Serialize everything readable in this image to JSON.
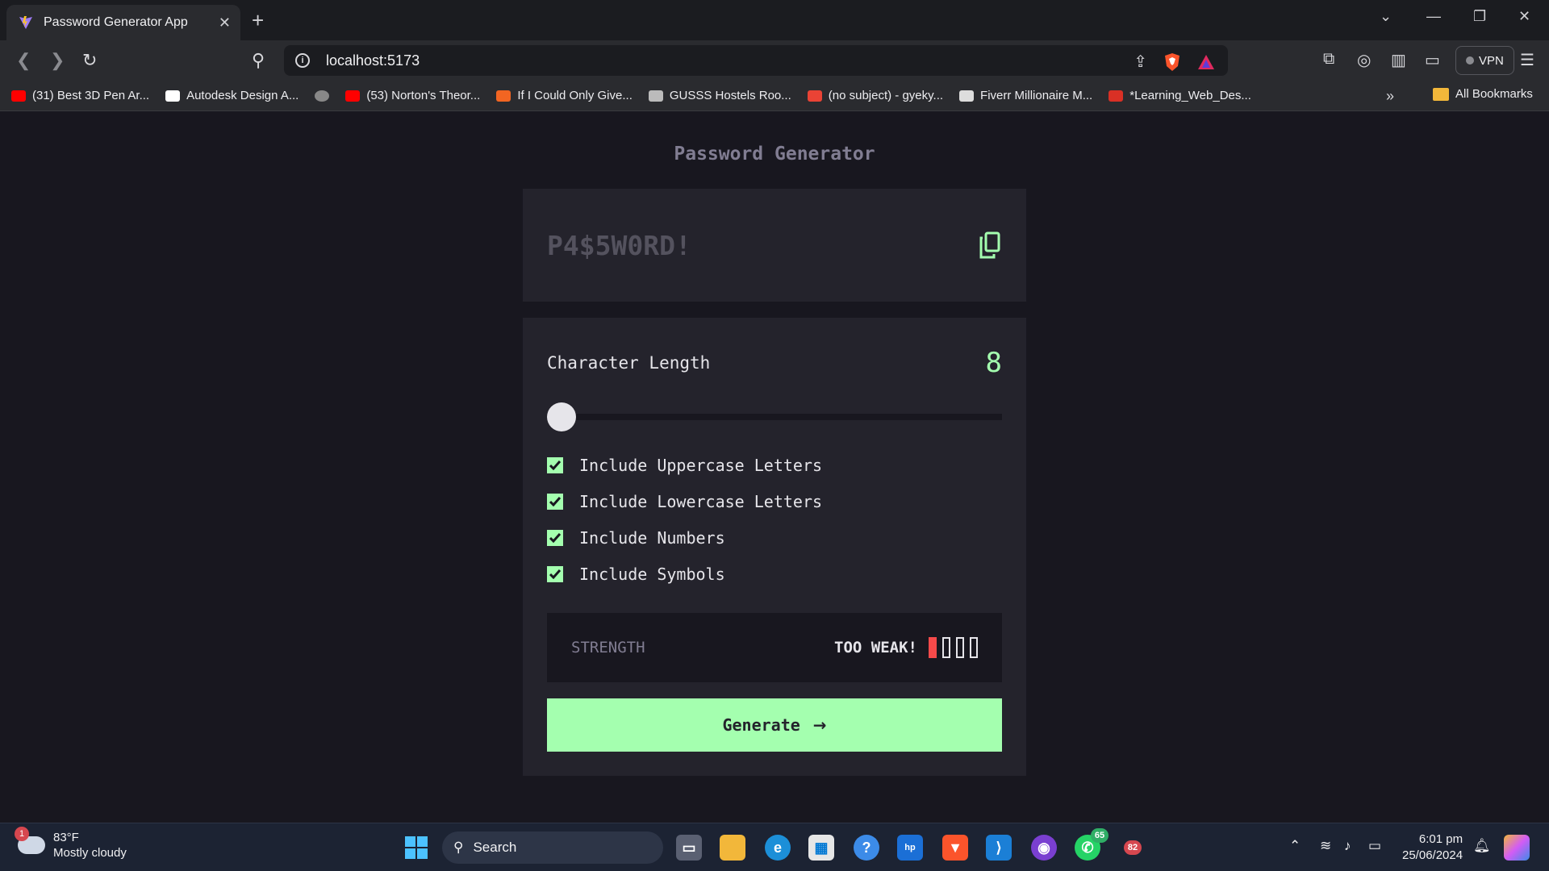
{
  "browser": {
    "tab_title": "Password Generator App",
    "url": "localhost:5173",
    "vpn_label": "VPN",
    "bookmarks": [
      {
        "label": "(31) Best 3D Pen Ar...",
        "color": "#ff0000"
      },
      {
        "label": "Autodesk Design A...",
        "color": "#ffffff"
      },
      {
        "label": "",
        "color": "#888888"
      },
      {
        "label": "(53) Norton's Theor...",
        "color": "#ff0000"
      },
      {
        "label": "If I Could Only Give...",
        "color": "#f26522"
      },
      {
        "label": "GUSSS Hostels Roo...",
        "color": "#bbbbbb"
      },
      {
        "label": "(no subject) - gyeky...",
        "color": "#ea4335"
      },
      {
        "label": "Fiverr Millionaire M...",
        "color": "#dddddd"
      },
      {
        "label": "*Learning_Web_Des...",
        "color": "#d93025"
      }
    ],
    "all_bookmarks_label": "All Bookmarks"
  },
  "app": {
    "title": "Password Generator",
    "password_placeholder": "P4$5W0RD!",
    "length_label": "Character Length",
    "length_value": "8",
    "length_fraction": 0.0,
    "options": [
      {
        "label": "Include Uppercase Letters",
        "checked": true
      },
      {
        "label": "Include Lowercase Letters",
        "checked": true
      },
      {
        "label": "Include Numbers",
        "checked": true
      },
      {
        "label": "Include Symbols",
        "checked": true
      }
    ],
    "strength_label": "STRENGTH",
    "strength_text": "TOO WEAK!",
    "strength_level": 1,
    "strength_max": 4,
    "generate_label": "Generate",
    "generate_arrow": "→",
    "colors": {
      "accent": "#a4ffaf",
      "weak": "#f64a4a",
      "card": "#24232c",
      "bg": "#18171f"
    }
  },
  "taskbar": {
    "weather_badge": "1",
    "temperature": "83°F",
    "condition": "Mostly cloudy",
    "search_label": "Search",
    "whatsapp_badge": "65",
    "other_badge": "82",
    "time": "6:01 pm",
    "date": "25/06/2024"
  }
}
